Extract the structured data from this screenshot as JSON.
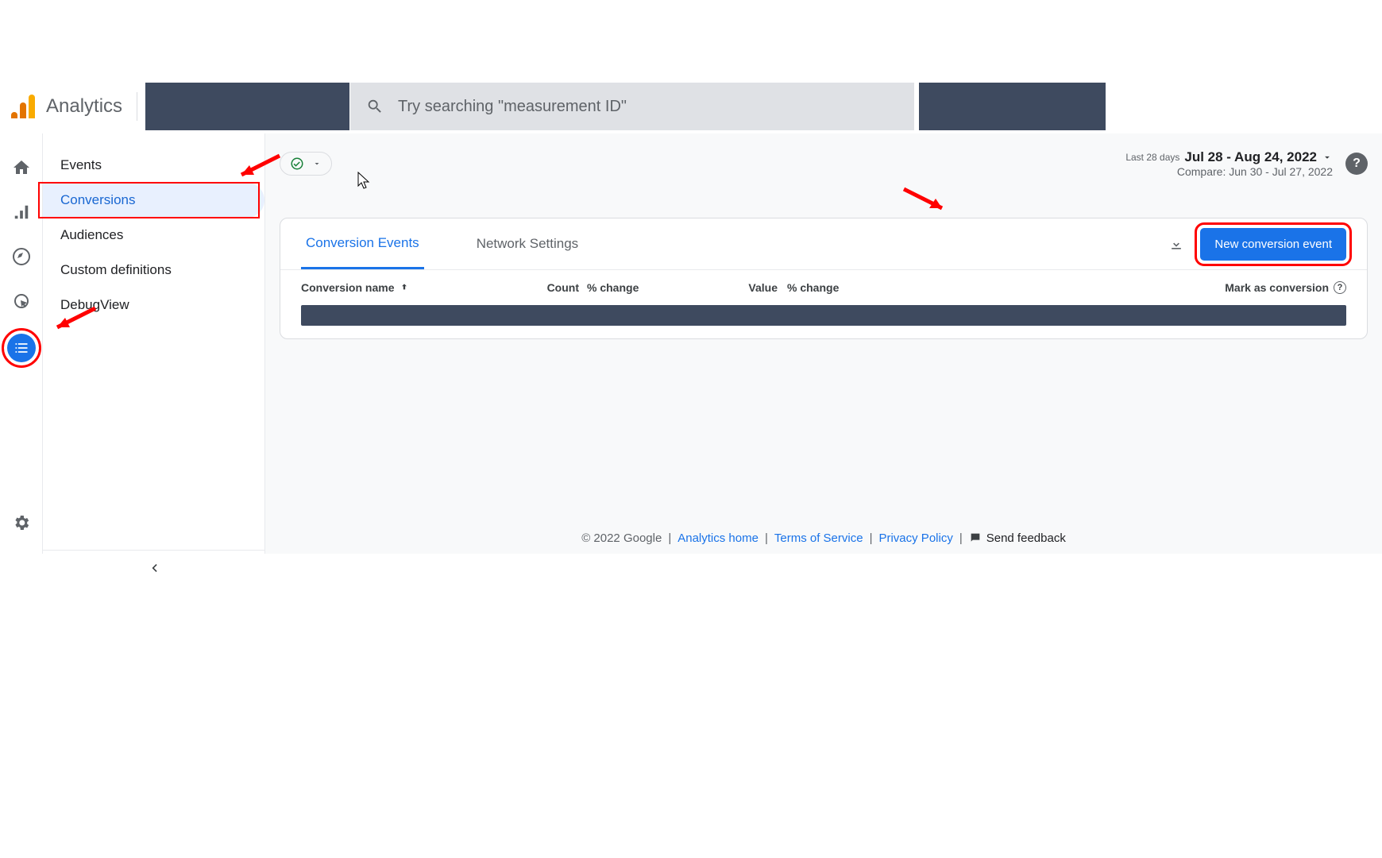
{
  "header": {
    "product": "Analytics",
    "search_placeholder": "Try searching \"measurement ID\""
  },
  "rail": {
    "home": "home-icon",
    "reports": "bar-chart-icon",
    "explore": "target-icon",
    "advertising": "click-cursor-icon",
    "configure": "list-icon",
    "settings": "gear-icon"
  },
  "nav2": {
    "items": [
      {
        "label": "Events"
      },
      {
        "label": "Conversions",
        "selected": true,
        "highlighted": true
      },
      {
        "label": "Audiences"
      },
      {
        "label": "Custom definitions"
      },
      {
        "label": "DebugView"
      }
    ]
  },
  "toolbar": {
    "date_prefix": "Last 28 days",
    "date_range": "Jul 28 - Aug 24, 2022",
    "compare_line": "Compare: Jun 30 - Jul 27, 2022"
  },
  "card": {
    "tabs": [
      {
        "label": "Conversion Events",
        "active": true
      },
      {
        "label": "Network Settings"
      }
    ],
    "new_button": "New conversion event",
    "columns": {
      "name": "Conversion name",
      "count": "Count",
      "pc1": "% change",
      "value": "Value",
      "pc2": "% change",
      "mark": "Mark as conversion"
    }
  },
  "footer": {
    "copyright": "© 2022 Google",
    "links": [
      "Analytics home",
      "Terms of Service",
      "Privacy Policy"
    ],
    "feedback": "Send feedback"
  }
}
